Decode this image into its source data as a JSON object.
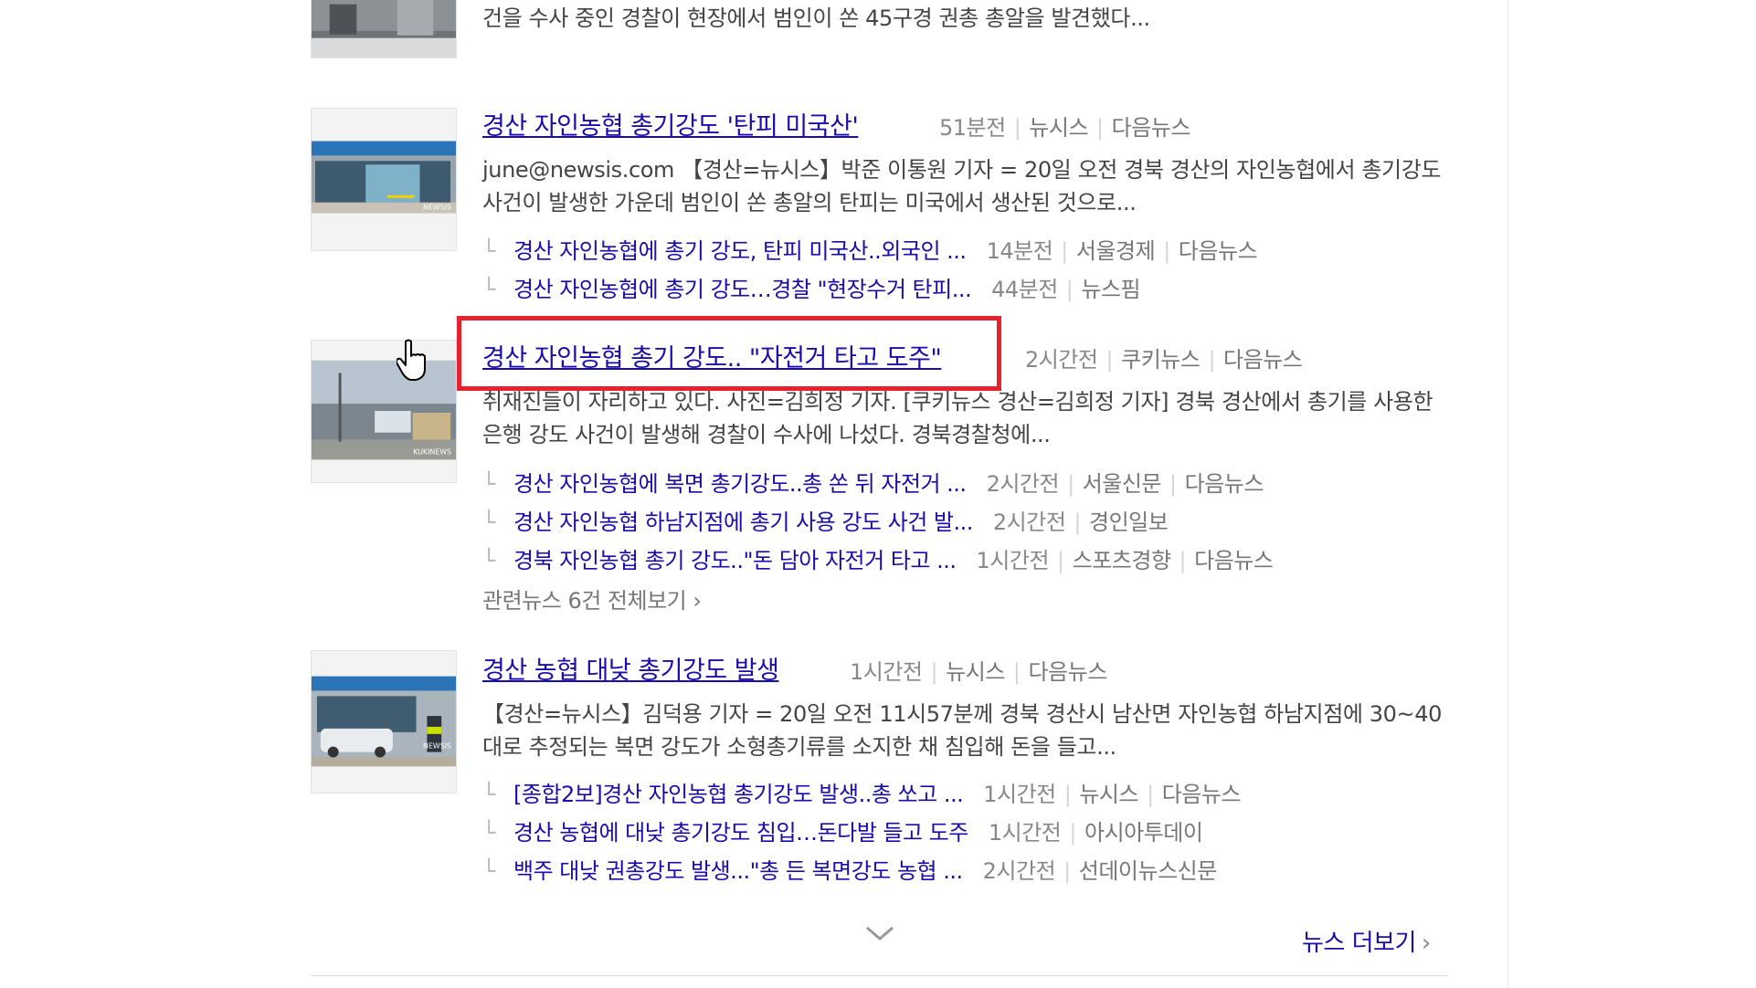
{
  "top_snippet": "건을 수사 중인 경찰이 현장에서 범인이 쏜 45구경 권총 총알을 발견했다...",
  "articles": [
    {
      "title": "경산 자인농협 총기강도 '탄피 미국산'",
      "time": "51분전",
      "source": "뉴시스",
      "portal": "다음뉴스",
      "snippet": "june@newsis.com 【경산=뉴시스】박준 이통원 기자 = 20일 오전 경북 경산의 자인농협에서 총기강도 사건이 발생한 가운데 범인이 쏜 총알의 탄피는 미국에서 생산된 것으로...",
      "related": [
        {
          "title": "경산 자인농협에 총기 강도, 탄피 미국산..외국인 ...",
          "time": "14분전",
          "source": "서울경제",
          "portal": "다음뉴스"
        },
        {
          "title": "경산 자인농협에 총기 강도…경찰 \"현장수거 탄피...",
          "time": "44분전",
          "source": "뉴스핌",
          "portal": ""
        }
      ]
    },
    {
      "title": "경산 자인농협 총기 강도.. \"자전거 타고 도주\"",
      "time": "2시간전",
      "source": "쿠키뉴스",
      "portal": "다음뉴스",
      "snippet": "취재진들이 자리하고 있다. 사진=김희정 기자. [쿠키뉴스 경산=김희정 기자] 경북 경산에서 총기를 사용한 은행 강도 사건이 발생해 경찰이 수사에 나섰다. 경북경찰청에...",
      "related": [
        {
          "title": "경산 자인농협에 복면 총기강도..총 쏜 뒤 자전거 ...",
          "time": "2시간전",
          "source": "서울신문",
          "portal": "다음뉴스"
        },
        {
          "title": "경산 자인농협 하남지점에 총기 사용 강도 사건 발...",
          "time": "2시간전",
          "source": "경인일보",
          "portal": ""
        },
        {
          "title": "경북 자인농협 총기 강도..\"돈 담아 자전거 타고 ...",
          "time": "1시간전",
          "source": "스포츠경향",
          "portal": "다음뉴스"
        }
      ],
      "more_related": "관련뉴스 6건 전체보기"
    },
    {
      "title": "경산 농협 대낮 총기강도 발생",
      "time": "1시간전",
      "source": "뉴시스",
      "portal": "다음뉴스",
      "snippet": "【경산=뉴시스】김덕용 기자 = 20일 오전 11시57분께 경북 경산시 남산면 자인농협 하남지점에 30~40대로 추정되는 복면 강도가 소형총기류를 소지한 채 침입해 돈을 들고...",
      "related": [
        {
          "title": "[종합2보]경산 자인농협 총기강도 발생..총 쏘고 ...",
          "time": "1시간전",
          "source": "뉴시스",
          "portal": "다음뉴스"
        },
        {
          "title": "경산 농협에 대낮 총기강도 침입…돈다발 들고 도주",
          "time": "1시간전",
          "source": "아시아투데이",
          "portal": ""
        },
        {
          "title": "백주 대낮 권총강도 발생...\"총 든 복면강도 농협 ...",
          "time": "2시간전",
          "source": "선데이뉴스신문",
          "portal": ""
        }
      ]
    }
  ],
  "news_more": "뉴스 더보기",
  "icons": {
    "chevron": "chevron-down-icon",
    "cursor": "hand-cursor-icon",
    "branch": "└"
  },
  "colors": {
    "link": "#1a0dab",
    "highlight": "#e8212f",
    "meta": "#888888"
  }
}
